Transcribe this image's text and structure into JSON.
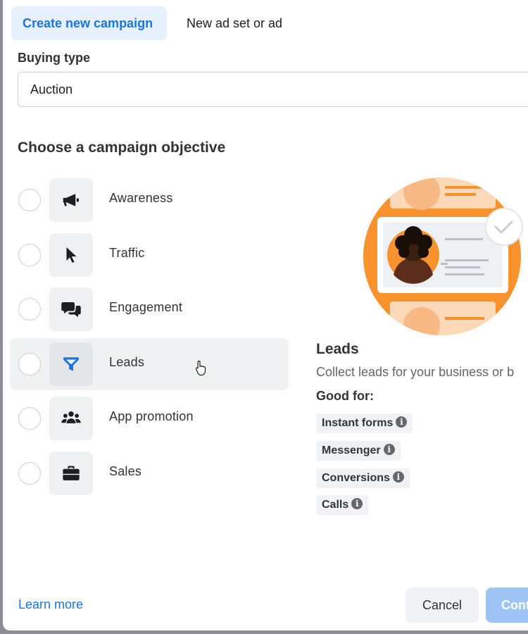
{
  "tabs": [
    {
      "label": "Create new campaign"
    },
    {
      "label": "New ad set or ad"
    }
  ],
  "buying_type": {
    "label": "Buying type",
    "value": "Auction"
  },
  "objective": {
    "title": "Choose a campaign objective",
    "options": [
      {
        "label": "Awareness",
        "icon": "megaphone-icon"
      },
      {
        "label": "Traffic",
        "icon": "cursor-icon"
      },
      {
        "label": "Engagement",
        "icon": "chat-bubbles-icon"
      },
      {
        "label": "Leads",
        "icon": "funnel-icon"
      },
      {
        "label": "App promotion",
        "icon": "people-icon"
      },
      {
        "label": "Sales",
        "icon": "briefcase-icon"
      }
    ],
    "hovered": "Leads"
  },
  "detail": {
    "title": "Leads",
    "description": "Collect leads for your business or b",
    "good_for_label": "Good for:",
    "chips": [
      {
        "label": "Instant forms"
      },
      {
        "label": "Messenger"
      },
      {
        "label": "Conversions"
      },
      {
        "label": "Calls"
      }
    ],
    "info_glyph": "i"
  },
  "footer": {
    "learn_more": "Learn more",
    "cancel": "Cancel",
    "continue": "Cont"
  },
  "colors": {
    "accent": "#1b74e4",
    "tab_active_bg": "#e7f0fd",
    "continue_disabled": "#9ec4f7",
    "illustration_orange": "#f7922c"
  }
}
